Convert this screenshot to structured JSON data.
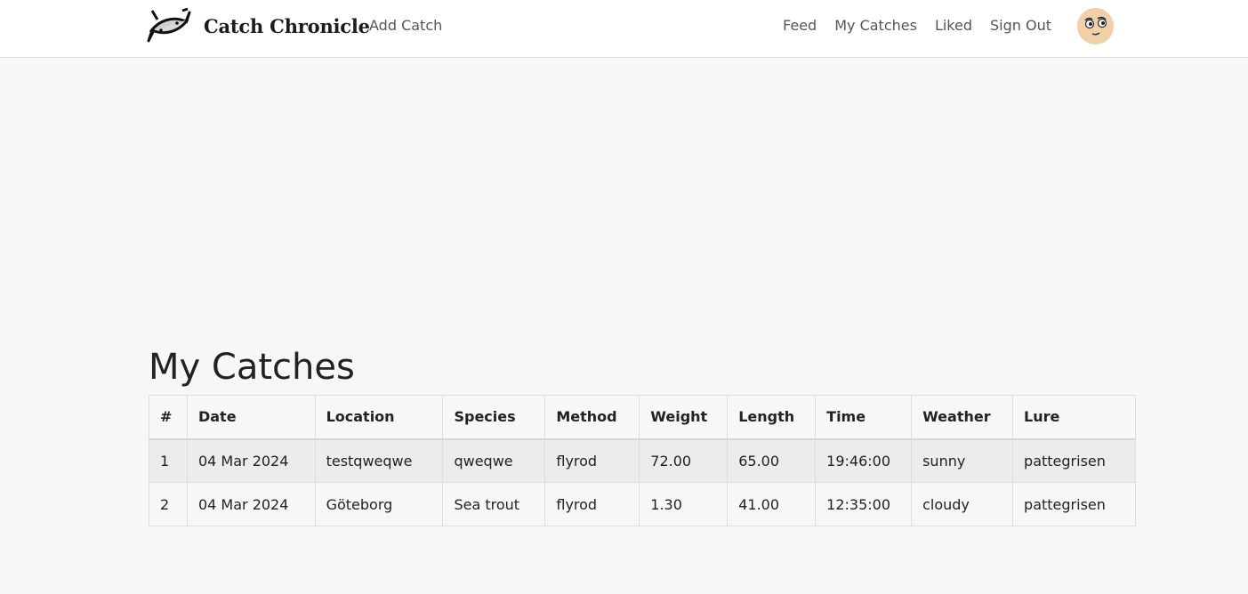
{
  "nav": {
    "brand": "Catch Chronicle",
    "add_catch": "Add Catch",
    "links": [
      "Feed",
      "My Catches",
      "Liked",
      "Sign Out"
    ],
    "logo_icon": "fish-logo-icon",
    "avatar_icon": "cartoon-face-avatar-icon"
  },
  "main": {
    "title": "My Catches"
  },
  "table": {
    "headers": [
      "#",
      "Date",
      "Location",
      "Species",
      "Method",
      "Weight",
      "Length",
      "Time",
      "Weather",
      "Lure"
    ],
    "rows": [
      [
        "1",
        "04 Mar 2024",
        "testqweqwe",
        "qweqwe",
        "flyrod",
        "72.00",
        "65.00",
        "19:46:00",
        "sunny",
        "pattegrisen"
      ],
      [
        "2",
        "04 Mar 2024",
        "Göteborg",
        "Sea trout",
        "flyrod",
        "1.30",
        "41.00",
        "12:35:00",
        "cloudy",
        "pattegrisen"
      ]
    ]
  }
}
